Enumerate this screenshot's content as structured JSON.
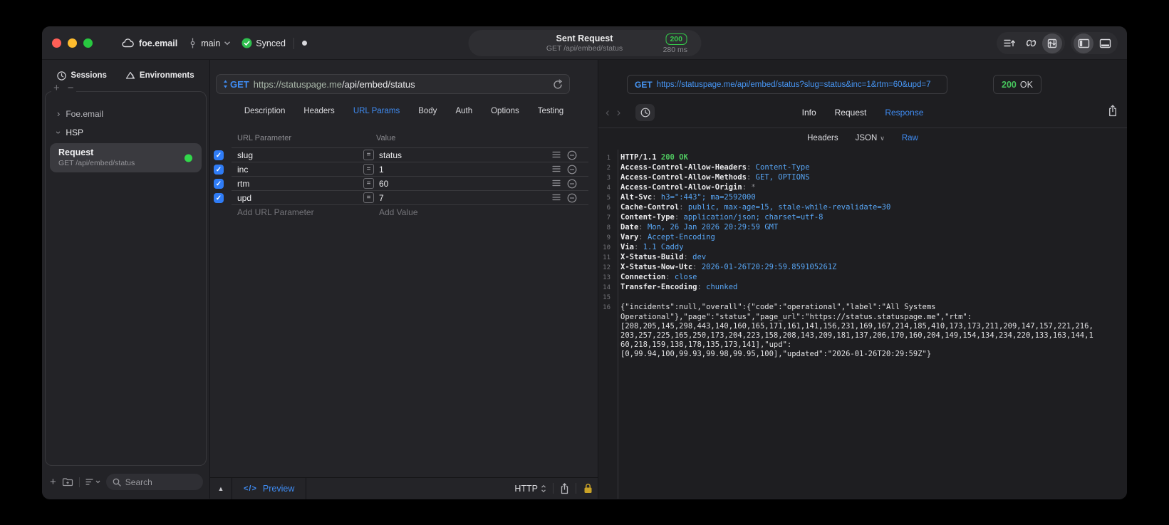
{
  "colors": {
    "accent_blue": "#3f8cf3",
    "status_green": "#32d74b",
    "badge_green": "#35c84b",
    "code_value_blue": "#58a6f5",
    "code_green": "#4fc860",
    "checkbox_blue": "#2f7cf6",
    "lock_gold": "#c9a227",
    "url_host_tint": "#a9b7a9"
  },
  "titlebar": {
    "project": "foe.email",
    "branch": "main",
    "sync_label": "Synced",
    "request_title": "Sent Request",
    "request_subtitle": "GET /api/embed/status",
    "status_code": "200",
    "duration": "280 ms"
  },
  "sidebar": {
    "tabs": [
      {
        "label": "Sessions",
        "active": true
      },
      {
        "label": "Environments",
        "active": false
      }
    ],
    "tree": [
      {
        "label": "Foe.email",
        "expanded": false
      },
      {
        "label": "HSP",
        "expanded": true
      }
    ],
    "request_item": {
      "title": "Request",
      "subtitle": "GET /api/embed/status"
    },
    "search_placeholder": "Search"
  },
  "request_panel": {
    "method": "GET",
    "url_protocol": "https://",
    "url_host": "statuspage.me",
    "url_path": "/api/embed/status",
    "tabs": [
      "Description",
      "Headers",
      "URL Params",
      "Body",
      "Auth",
      "Options",
      "Testing"
    ],
    "active_tab": "URL Params",
    "param_table": {
      "col_param": "URL Parameter",
      "col_value": "Value",
      "rows": [
        {
          "name": "slug",
          "value": "status",
          "checked": true
        },
        {
          "name": "inc",
          "value": "1",
          "checked": true
        },
        {
          "name": "rtm",
          "value": "60",
          "checked": true
        },
        {
          "name": "upd",
          "value": "7",
          "checked": true
        }
      ],
      "add_param_placeholder": "Add URL Parameter",
      "add_value_placeholder": "Add Value"
    },
    "footer": {
      "code_glyph": "</>",
      "preview_label": "Preview",
      "protocol_label": "HTTP"
    }
  },
  "response_panel": {
    "method": "GET",
    "url": "https://statuspage.me/api/embed/status?slug=status&inc=1&rtm=60&upd=7",
    "status_code": "200",
    "status_text": "OK",
    "tabs": [
      {
        "label": "Info",
        "active": false
      },
      {
        "label": "Request",
        "active": false
      },
      {
        "label": "Response",
        "active": true
      }
    ],
    "subtabs": [
      {
        "label": "Headers",
        "active": false,
        "dropdown": false
      },
      {
        "label": "JSON",
        "active": false,
        "dropdown": true
      },
      {
        "label": "Raw",
        "active": true,
        "dropdown": false
      }
    ],
    "code_lines": [
      {
        "n": "1",
        "parts": [
          {
            "t": "HTTP/1.1 ",
            "c": "n"
          },
          {
            "t": "200 OK",
            "c": "g"
          }
        ]
      },
      {
        "n": "2",
        "parts": [
          {
            "t": "Access-Control-Allow-Headers",
            "c": "n"
          },
          {
            "t": ": ",
            "c": "d"
          },
          {
            "t": "Content-Type",
            "c": "v"
          }
        ]
      },
      {
        "n": "3",
        "parts": [
          {
            "t": "Access-Control-Allow-Methods",
            "c": "n"
          },
          {
            "t": ": ",
            "c": "d"
          },
          {
            "t": "GET, OPTIONS",
            "c": "v"
          }
        ]
      },
      {
        "n": "4",
        "parts": [
          {
            "t": "Access-Control-Allow-Origin",
            "c": "n"
          },
          {
            "t": ": ",
            "c": "d"
          },
          {
            "t": "*",
            "c": "d"
          }
        ]
      },
      {
        "n": "5",
        "parts": [
          {
            "t": "Alt-Svc",
            "c": "n"
          },
          {
            "t": ": ",
            "c": "d"
          },
          {
            "t": "h3=\":443\"; ma=2592000",
            "c": "v"
          }
        ]
      },
      {
        "n": "6",
        "parts": [
          {
            "t": "Cache-Control",
            "c": "n"
          },
          {
            "t": ": ",
            "c": "d"
          },
          {
            "t": "public, max-age=15, stale-while-revalidate=30",
            "c": "v"
          }
        ]
      },
      {
        "n": "7",
        "parts": [
          {
            "t": "Content-Type",
            "c": "n"
          },
          {
            "t": ": ",
            "c": "d"
          },
          {
            "t": "application/json; charset=utf-8",
            "c": "v"
          }
        ]
      },
      {
        "n": "8",
        "parts": [
          {
            "t": "Date",
            "c": "n"
          },
          {
            "t": ": ",
            "c": "d"
          },
          {
            "t": "Mon, 26 Jan 2026 20:29:59 GMT",
            "c": "v"
          }
        ]
      },
      {
        "n": "9",
        "parts": [
          {
            "t": "Vary",
            "c": "n"
          },
          {
            "t": ": ",
            "c": "d"
          },
          {
            "t": "Accept-Encoding",
            "c": "v"
          }
        ]
      },
      {
        "n": "10",
        "parts": [
          {
            "t": "Via",
            "c": "n"
          },
          {
            "t": ": ",
            "c": "d"
          },
          {
            "t": "1.1 Caddy",
            "c": "v"
          }
        ]
      },
      {
        "n": "11",
        "parts": [
          {
            "t": "X-Status-Build",
            "c": "n"
          },
          {
            "t": ": ",
            "c": "d"
          },
          {
            "t": "dev",
            "c": "v"
          }
        ]
      },
      {
        "n": "12",
        "parts": [
          {
            "t": "X-Status-Now-Utc",
            "c": "n"
          },
          {
            "t": ": ",
            "c": "d"
          },
          {
            "t": "2026-01-26T20:29:59.859105261Z",
            "c": "v"
          }
        ]
      },
      {
        "n": "13",
        "parts": [
          {
            "t": "Connection",
            "c": "n"
          },
          {
            "t": ": ",
            "c": "d"
          },
          {
            "t": "close",
            "c": "v"
          }
        ]
      },
      {
        "n": "14",
        "parts": [
          {
            "t": "Transfer-Encoding",
            "c": "n"
          },
          {
            "t": ": ",
            "c": "d"
          },
          {
            "t": "chunked",
            "c": "v"
          }
        ]
      },
      {
        "n": "15",
        "parts": []
      },
      {
        "n": "16",
        "parts": [
          {
            "t": "{\"incidents\":null,\"overall\":{\"code\":\"operational\",\"label\":\"All Systems",
            "c": "w"
          }
        ]
      },
      {
        "n": "",
        "parts": [
          {
            "t": "Operational\"},\"page\":\"status\",\"page_url\":\"https://status.statuspage.me\",\"rtm\":",
            "c": "w"
          }
        ]
      },
      {
        "n": "",
        "parts": [
          {
            "t": "[208,205,145,298,443,140,160,165,171,161,141,156,231,169,167,214,185,410,173,173,211,209,147,157,221,216,",
            "c": "w"
          }
        ]
      },
      {
        "n": "",
        "parts": [
          {
            "t": "203,257,225,165,250,173,204,223,158,208,143,209,181,137,206,170,160,204,149,154,134,234,220,133,163,144,1",
            "c": "w"
          }
        ]
      },
      {
        "n": "",
        "parts": [
          {
            "t": "60,218,159,138,178,135,173,141],\"upd\":",
            "c": "w"
          }
        ]
      },
      {
        "n": "",
        "parts": [
          {
            "t": "[0,99.94,100,99.93,99.98,99.95,100],\"updated\":\"2026-01-26T20:29:59Z\"}",
            "c": "w"
          }
        ]
      }
    ]
  }
}
